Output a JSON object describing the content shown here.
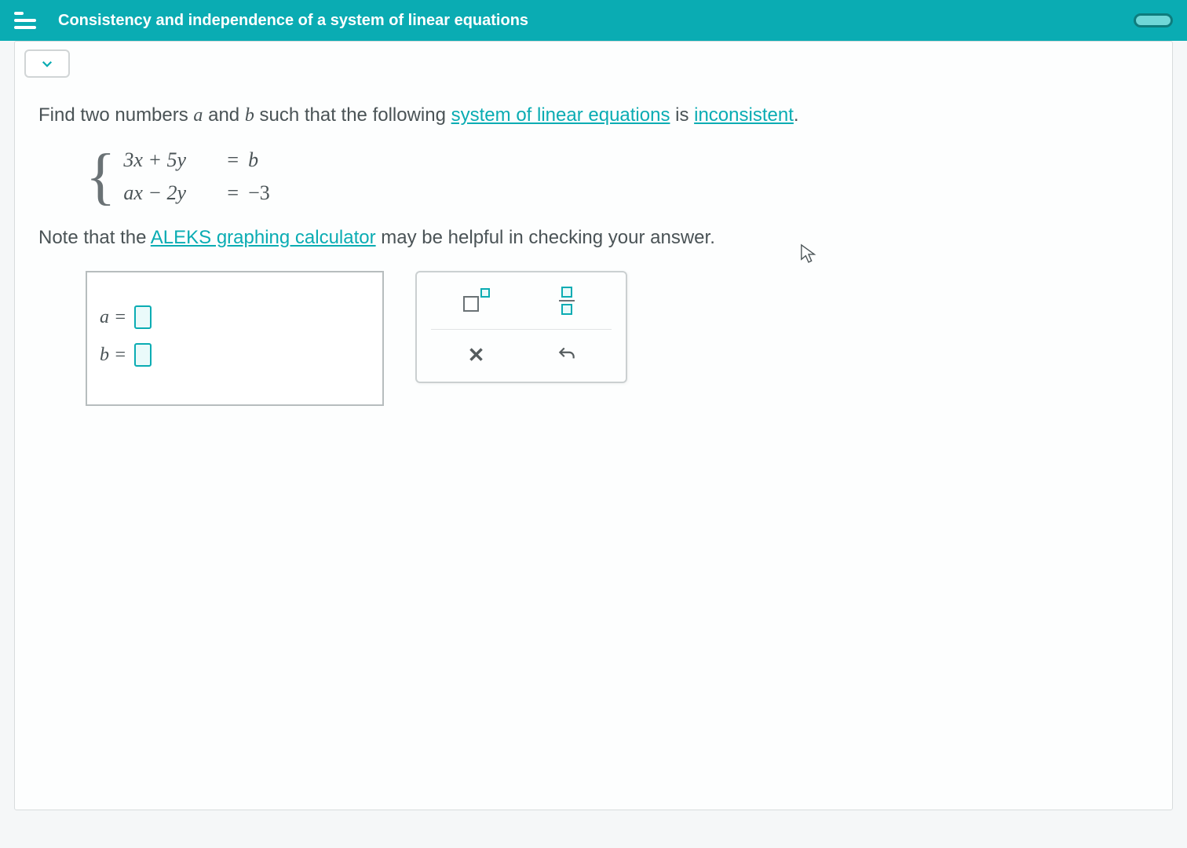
{
  "header": {
    "title": "Consistency and independence of a system of linear equations"
  },
  "problem": {
    "prompt_prefix": "Find two numbers ",
    "var_a": "a",
    "prompt_and": " and ",
    "var_b": "b",
    "prompt_mid": " such that the following ",
    "link_system": "system of linear equations",
    "prompt_is": " is ",
    "link_inconsistent": "inconsistent",
    "prompt_end": "."
  },
  "equations": {
    "eq1_lhs": "3x + 5y",
    "eq1_eq": "=",
    "eq1_rhs": "b",
    "eq2_lhs": "ax − 2y",
    "eq2_eq": "=",
    "eq2_rhs": "−3"
  },
  "note": {
    "prefix": "Note that the ",
    "link": "ALEKS graphing calculator",
    "suffix": " may be helpful in checking your answer."
  },
  "answers": {
    "a_label": "a =",
    "b_label": "b ="
  },
  "tools": {
    "clear": "✕"
  }
}
